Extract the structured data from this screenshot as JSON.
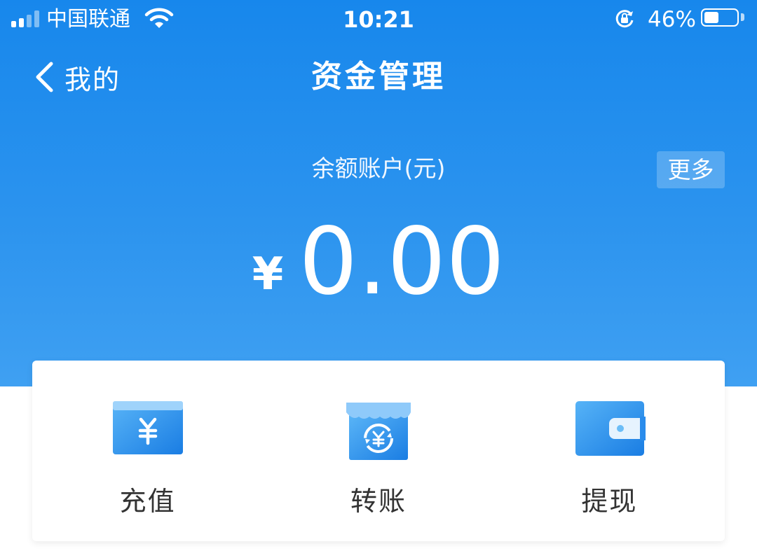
{
  "status_bar": {
    "carrier": "中国联通",
    "time": "10:21",
    "battery_percent": "46%",
    "battery_level": 0.46,
    "signal_bars": 4,
    "signal_active": 2
  },
  "nav": {
    "back_label": "我的",
    "title": "资金管理"
  },
  "balance": {
    "label": "余额账户(元)",
    "currency_symbol": "¥",
    "amount": "0.00",
    "more_label": "更多"
  },
  "actions": [
    {
      "label": "充值",
      "icon": "recharge-card-icon"
    },
    {
      "label": "转账",
      "icon": "transfer-shop-icon"
    },
    {
      "label": "提现",
      "icon": "wallet-icon"
    }
  ],
  "colors": {
    "header_top": "#1787ec",
    "header_bottom": "#3fa0f2",
    "accent": "#2a8cec",
    "text_dark": "#333333"
  }
}
